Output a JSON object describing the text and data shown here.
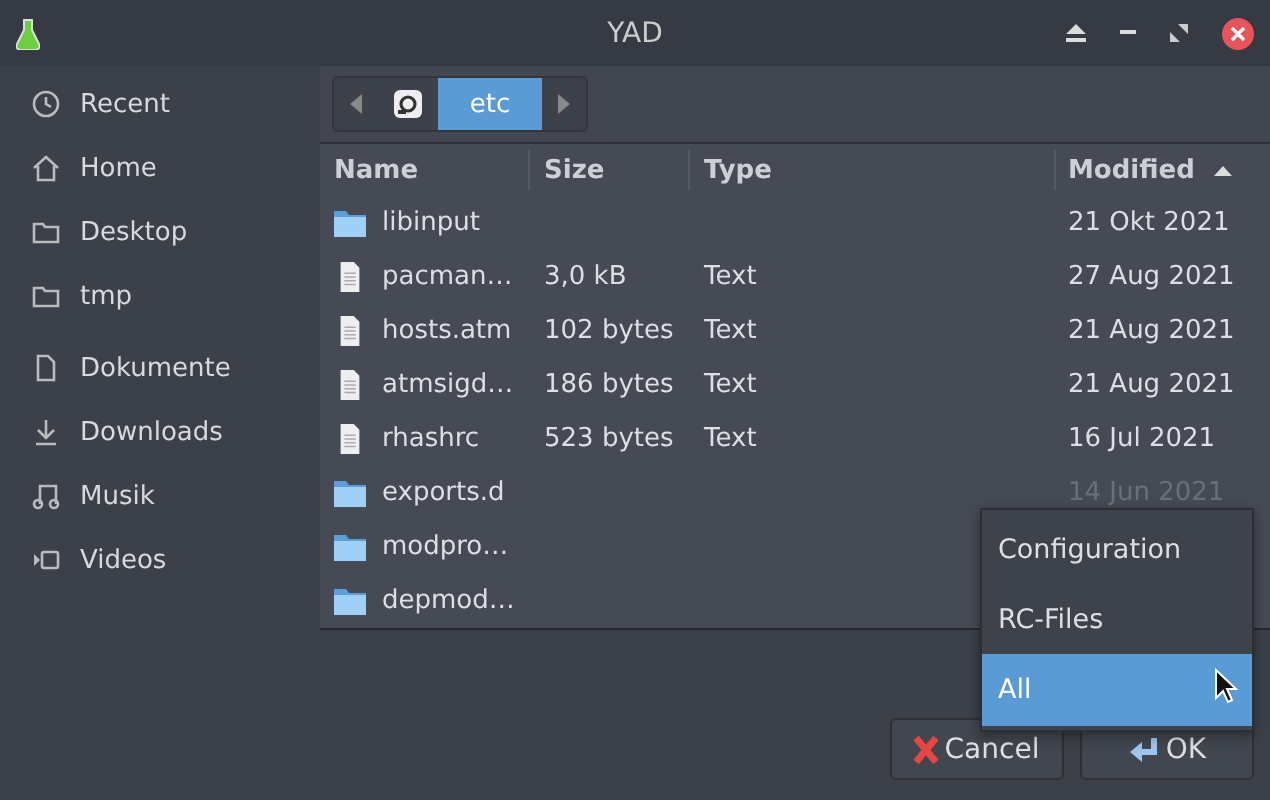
{
  "window": {
    "title": "YAD"
  },
  "sidebar": {
    "items": [
      {
        "label": "Recent"
      },
      {
        "label": "Home"
      },
      {
        "label": "Desktop"
      },
      {
        "label": "tmp"
      },
      {
        "label": "Dokumente"
      },
      {
        "label": "Downloads"
      },
      {
        "label": "Musik"
      },
      {
        "label": "Videos"
      }
    ]
  },
  "path_bar": {
    "segments": [
      {
        "kind": "root",
        "selected": false
      },
      {
        "kind": "text",
        "label": "etc",
        "selected": true
      }
    ]
  },
  "table": {
    "columns": [
      {
        "label": "Name",
        "sorted": false
      },
      {
        "label": "Size",
        "sorted": false
      },
      {
        "label": "Type",
        "sorted": false
      },
      {
        "label": "Modified",
        "sorted": true
      }
    ],
    "rows": [
      {
        "kind": "folder",
        "name": "libinput",
        "modified": "21 Okt 2021"
      },
      {
        "kind": "file",
        "name": "pacman…",
        "size": "3,0 kB",
        "type": "Text",
        "modified": "27 Aug 2021"
      },
      {
        "kind": "file",
        "name": "hosts.atm",
        "size": "102 bytes",
        "type": "Text",
        "modified": "21 Aug 2021"
      },
      {
        "kind": "file",
        "name": "atmsigd…",
        "size": "186 bytes",
        "type": "Text",
        "modified": "21 Aug 2021"
      },
      {
        "kind": "file",
        "name": "rhashrc",
        "size": "523 bytes",
        "type": "Text",
        "modified": "16 Jul 2021"
      },
      {
        "kind": "folder",
        "name": "exports.d",
        "modified": "14 Jun 2021"
      },
      {
        "kind": "folder",
        "name": "modpro…"
      },
      {
        "kind": "folder",
        "name": "depmod…"
      }
    ]
  },
  "filter_menu": {
    "items": [
      {
        "label": "Configuration",
        "selected": false
      },
      {
        "label": "RC-Files",
        "selected": false
      },
      {
        "label": "All",
        "selected": true
      }
    ]
  },
  "buttons": [
    {
      "kind": "cancel",
      "label": "Cancel"
    },
    {
      "kind": "ok",
      "label": "OK"
    }
  ]
}
